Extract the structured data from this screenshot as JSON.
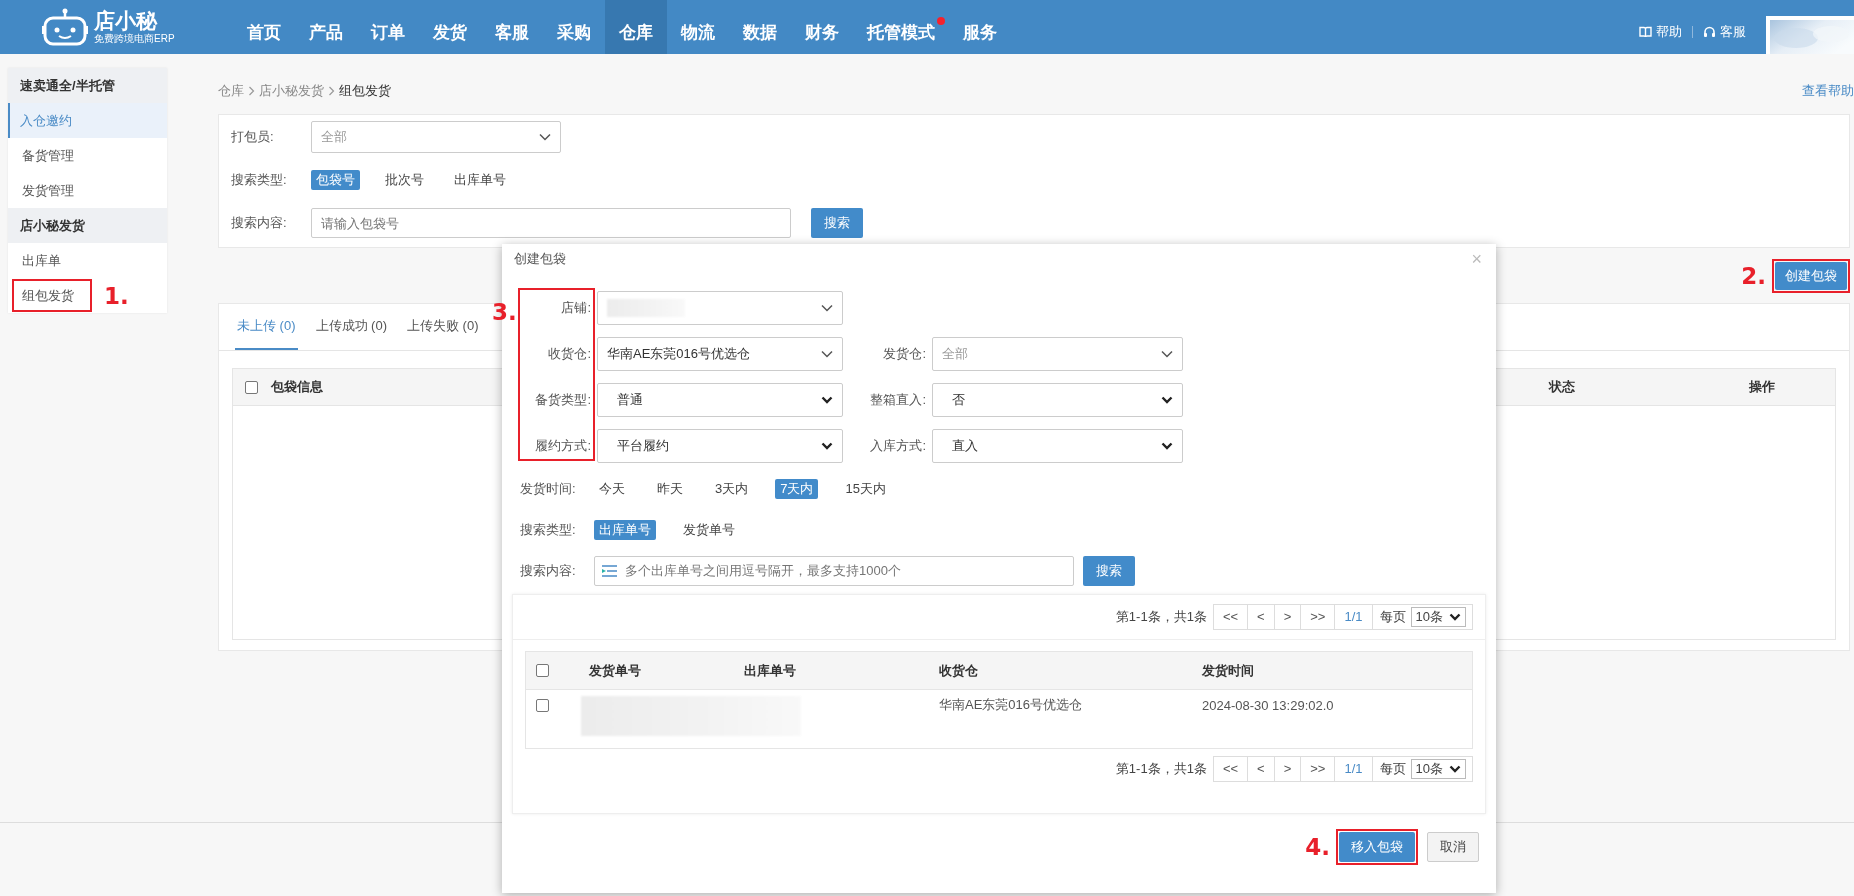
{
  "header": {
    "logo": {
      "name": "店小秘",
      "tagline": "免费跨境电商ERP"
    },
    "nav": [
      {
        "label": "首页",
        "selected": false,
        "dot": false
      },
      {
        "label": "产品",
        "selected": false,
        "dot": false
      },
      {
        "label": "订单",
        "selected": false,
        "dot": false
      },
      {
        "label": "发货",
        "selected": false,
        "dot": false
      },
      {
        "label": "客服",
        "selected": false,
        "dot": false
      },
      {
        "label": "采购",
        "selected": false,
        "dot": false
      },
      {
        "label": "仓库",
        "selected": true,
        "dot": false
      },
      {
        "label": "物流",
        "selected": false,
        "dot": false
      },
      {
        "label": "数据",
        "selected": false,
        "dot": false
      },
      {
        "label": "财务",
        "selected": false,
        "dot": false
      },
      {
        "label": "托管模式",
        "selected": false,
        "dot": true
      },
      {
        "label": "服务",
        "selected": false,
        "dot": false
      }
    ],
    "links": [
      {
        "label": "帮助",
        "kind": "book"
      },
      {
        "label": "客服",
        "kind": "headset"
      }
    ]
  },
  "sidebar": {
    "groups": [
      {
        "title": "速卖通全/半托管",
        "items": [
          {
            "label": "入仓邀约",
            "selected": true
          },
          {
            "label": "备货管理",
            "selected": false
          },
          {
            "label": "发货管理",
            "selected": false
          }
        ]
      },
      {
        "title": "店小秘发货",
        "items": [
          {
            "label": "出库单",
            "selected": false
          },
          {
            "label": "组包发货",
            "selected": false,
            "marker": "1."
          }
        ]
      }
    ]
  },
  "breadcrumb": [
    "仓库",
    "店小秘发货",
    "组包发货"
  ],
  "help_link": "查看帮助",
  "filters": {
    "packer": {
      "label": "打包员:",
      "placeholder": "全部"
    },
    "search_type": {
      "label": "搜索类型:",
      "options": [
        {
          "label": "包袋号",
          "selected": true
        },
        {
          "label": "批次号",
          "selected": false
        },
        {
          "label": "出库单号",
          "selected": false
        }
      ]
    },
    "search_content": {
      "label": "搜索内容:",
      "placeholder": "请输入包袋号"
    },
    "search_button": "搜索"
  },
  "create_button": {
    "label": "创建包袋",
    "marker": "2."
  },
  "tabs": [
    {
      "label": "未上传 (0)",
      "selected": true
    },
    {
      "label": "上传成功 (0)",
      "selected": false
    },
    {
      "label": "上传失败 (0)",
      "selected": false
    }
  ],
  "table": {
    "select_all_checked": false,
    "columns": [
      "包袋信息",
      "状态",
      "操作"
    ]
  },
  "dialog": {
    "title": "创建包袋",
    "close": "×",
    "marker": "3.",
    "rows": [
      [
        {
          "label": "店铺:",
          "kind": "select",
          "value_redacted": true
        }
      ],
      [
        {
          "label": "收货仓:",
          "kind": "select",
          "value": "华南AE东莞016号优选仓"
        },
        {
          "label": "发货仓:",
          "kind": "select",
          "placeholder": "全部"
        }
      ],
      [
        {
          "label": "备货类型:",
          "kind": "native",
          "value": "普通"
        },
        {
          "label": "整箱直入:",
          "kind": "native",
          "value": "否"
        }
      ],
      [
        {
          "label": "履约方式:",
          "kind": "native",
          "value": "平台履约"
        },
        {
          "label": "入库方式:",
          "kind": "native",
          "value": "直入"
        }
      ]
    ],
    "ship_time": {
      "label": "发货时间:",
      "options": [
        {
          "label": "今天",
          "selected": false
        },
        {
          "label": "昨天",
          "selected": false
        },
        {
          "label": "3天内",
          "selected": false
        },
        {
          "label": "7天内",
          "selected": true
        },
        {
          "label": "15天内",
          "selected": false
        }
      ]
    },
    "search_type": {
      "label": "搜索类型:",
      "options": [
        {
          "label": "出库单号",
          "selected": true
        },
        {
          "label": "发货单号",
          "selected": false
        }
      ]
    },
    "search": {
      "label": "搜索内容:",
      "placeholder": "多个出库单号之间用逗号隔开，最多支持1000个",
      "button": "搜索"
    },
    "pager_top": {
      "summary": "第1-1条，共1条",
      "buttons": [
        "<<",
        "<",
        ">",
        ">>"
      ],
      "page": "1/1",
      "per_page_label": "每页",
      "per_page": "10条"
    },
    "table": {
      "select_all_checked": false,
      "columns": [
        "发货单号",
        "出库单号",
        "收货仓",
        "发货时间"
      ],
      "rows": [
        {
          "checked": false,
          "numbers_redacted": true,
          "warehouse": "华南AE东莞016号优选仓",
          "time": "2024-08-30 13:29:02.0"
        }
      ]
    },
    "pager_bottom": {
      "summary": "第1-1条，共1条",
      "buttons": [
        "<<",
        "<",
        ">",
        ">>"
      ],
      "page": "1/1",
      "per_page_label": "每页",
      "per_page": "10条"
    },
    "buttons": [
      {
        "label": "移入包袋",
        "kind": "primary",
        "marker": "4."
      },
      {
        "label": "取消",
        "kind": "default"
      }
    ]
  }
}
